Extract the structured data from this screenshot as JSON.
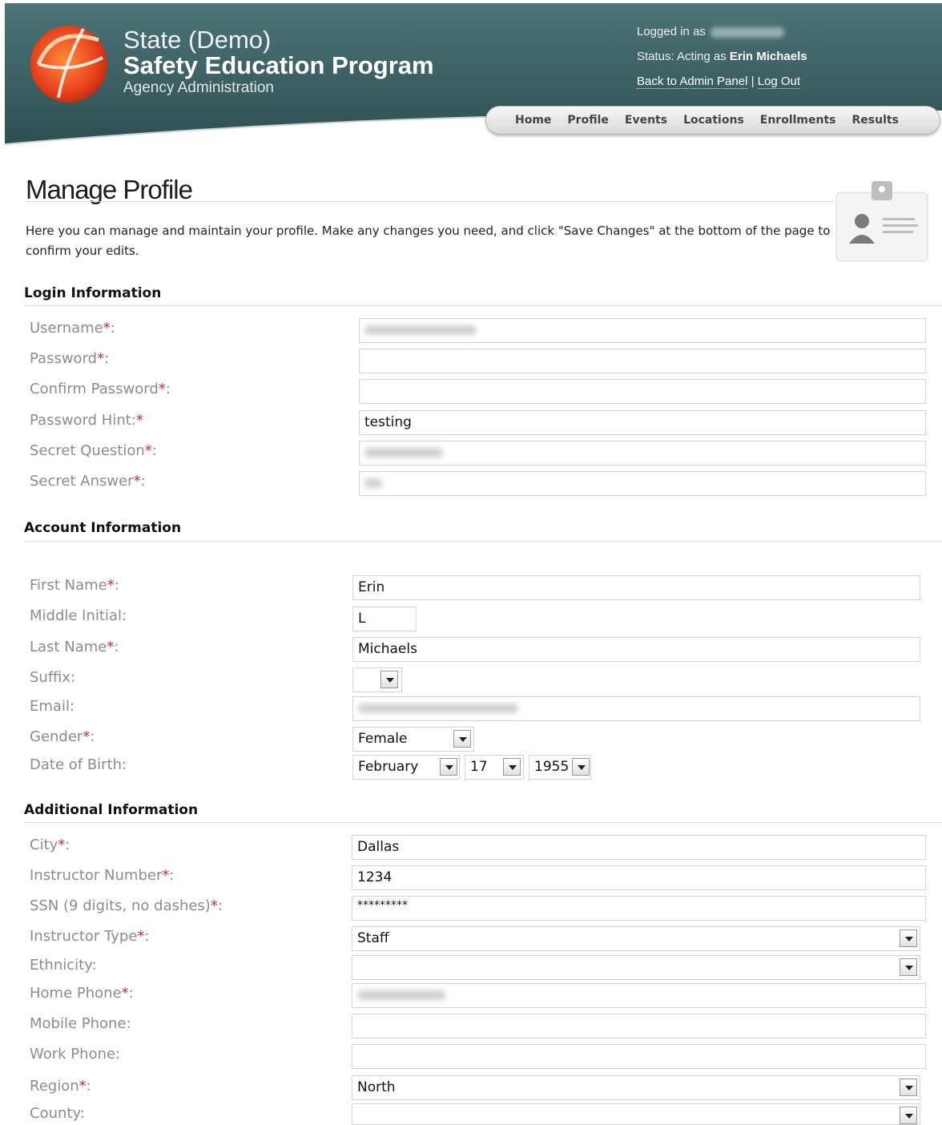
{
  "header": {
    "brand_line1": "State (Demo)",
    "brand_line2": "Safety Education Program",
    "brand_line3": "Agency Administration",
    "logged_in_label": "Logged in as",
    "status_prefix": "Status: Acting as",
    "status_name": "Erin Michaels",
    "back_link": "Back to Admin Panel",
    "separator": "|",
    "logout_link": "Log Out"
  },
  "nav": {
    "items": [
      "Home",
      "Profile",
      "Events",
      "Locations",
      "Enrollments",
      "Results"
    ]
  },
  "page": {
    "title": "Manage Profile",
    "intro": "Here you can manage and maintain your profile. Make any changes you need, and click \"Save Changes\" at the bottom of the page to confirm your edits."
  },
  "sections": {
    "login": "Login Information",
    "account": "Account Information",
    "additional": "Additional Information"
  },
  "required_mark": "*",
  "login": {
    "username_label": "Username",
    "password_label": "Password",
    "confirm_label": "Confirm Password",
    "hint_label": "Password Hint:",
    "hint_value": "testing",
    "question_label": "Secret Question",
    "answer_label": "Secret Answer"
  },
  "account": {
    "first_label": "First Name",
    "first_value": "Erin",
    "middle_label": "Middle Initial:",
    "middle_value": "L",
    "last_label": "Last Name",
    "last_value": "Michaels",
    "suffix_label": "Suffix:",
    "email_label": "Email:",
    "gender_label": "Gender",
    "gender_value": "Female",
    "dob_label": "Date of Birth:",
    "dob_month": "February",
    "dob_day": "17",
    "dob_year": "1955"
  },
  "additional": {
    "city_label": "City",
    "city_value": "Dallas",
    "instructor_number_label": "Instructor Number",
    "instructor_number_value": "1234",
    "ssn_label": "SSN (9 digits, no dashes)",
    "ssn_value": "*********",
    "instructor_type_label": "Instructor Type",
    "instructor_type_value": "Staff",
    "ethnicity_label": "Ethnicity:",
    "home_phone_label": "Home Phone",
    "mobile_phone_label": "Mobile Phone:",
    "work_phone_label": "Work Phone:",
    "region_label": "Region",
    "region_value": "North",
    "county_label": "County:"
  },
  "colors": {
    "header_bg": "#3f6467",
    "required": "#cc2a3a",
    "label": "#8c8c8c"
  }
}
